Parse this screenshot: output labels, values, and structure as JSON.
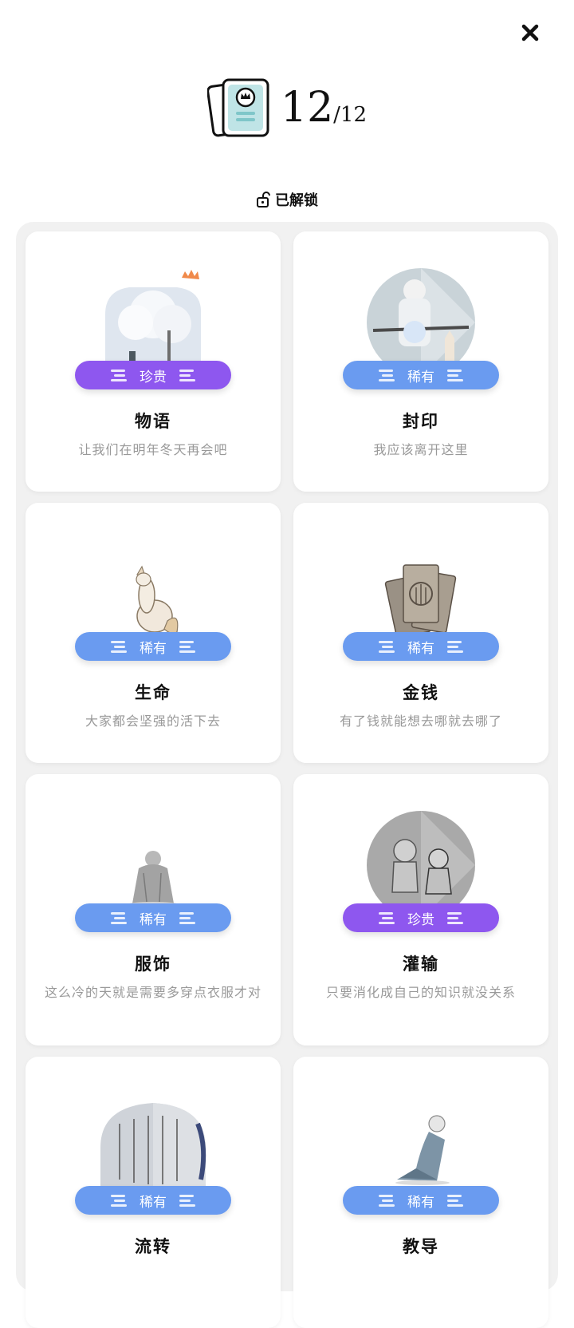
{
  "header": {
    "count": "12",
    "total": "/12"
  },
  "status": {
    "label": "已解锁"
  },
  "cards": [
    {
      "title": "物语",
      "desc": "让我们在明年冬天再会吧",
      "rarity": "珍贵",
      "rarity_color": "#8e57ef"
    },
    {
      "title": "封印",
      "desc": "我应该离开这里",
      "rarity": "稀有",
      "rarity_color": "#6a9bf0"
    },
    {
      "title": "生命",
      "desc": "大家都会坚强的活下去",
      "rarity": "稀有",
      "rarity_color": "#6a9bf0"
    },
    {
      "title": "金钱",
      "desc": "有了钱就能想去哪就去哪了",
      "rarity": "稀有",
      "rarity_color": "#6a9bf0"
    },
    {
      "title": "服饰",
      "desc": "这么冷的天就是需要多穿点衣服才对",
      "rarity": "稀有",
      "rarity_color": "#6a9bf0"
    },
    {
      "title": "灌输",
      "desc": "只要消化成自己的知识就没关系",
      "rarity": "珍贵",
      "rarity_color": "#8e57ef"
    },
    {
      "title": "流转",
      "desc": "",
      "rarity": "稀有",
      "rarity_color": "#6a9bf0"
    },
    {
      "title": "教导",
      "desc": "",
      "rarity": "稀有",
      "rarity_color": "#6a9bf0"
    }
  ],
  "icons": {
    "close": "close-icon",
    "cards": "card-collection-icon",
    "unlock": "unlock-icon"
  }
}
